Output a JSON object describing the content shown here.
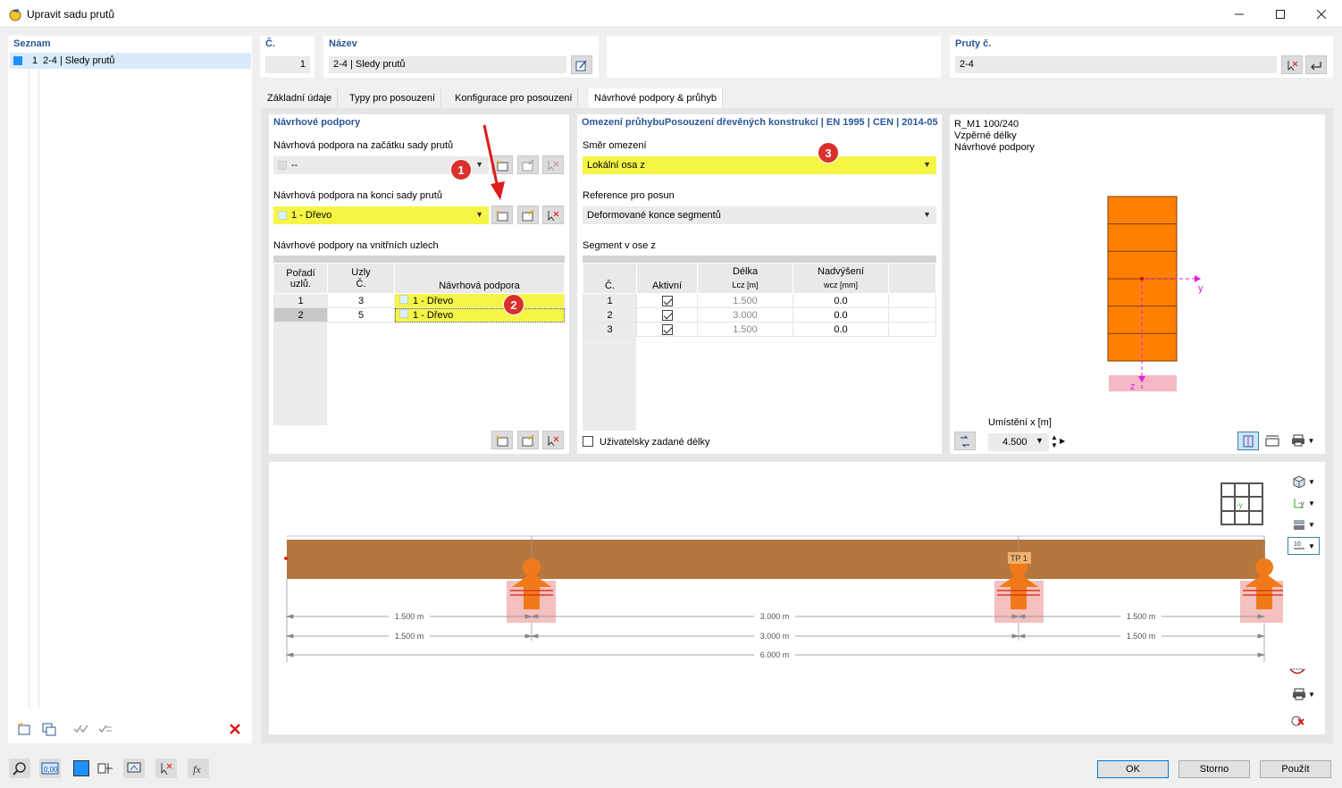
{
  "window": {
    "title": "Upravit sadu prutů"
  },
  "list": {
    "header": "Seznam",
    "items": [
      {
        "number": "1",
        "label": "2-4 | Sledy prutů",
        "color": "#1e90ff"
      }
    ]
  },
  "top": {
    "number_label": "Č.",
    "number_value": "1",
    "name_label": "Název",
    "name_value": "2-4 | Sledy prutů",
    "members_label": "Pruty č.",
    "members_value": "2-4"
  },
  "tabs": [
    {
      "label": "Základní údaje"
    },
    {
      "label": "Typy pro posouzení"
    },
    {
      "label": "Konfigurace pro posouzení"
    },
    {
      "label": "Návrhové podpory & průhyb"
    }
  ],
  "design_supports": {
    "header": "Návrhové podpory",
    "start_label": "Návrhová podpora na začátku sady prutů",
    "start_value": "--",
    "end_label": "Návrhová podpora na konci sady prutů",
    "end_value": "1 - Dřevo",
    "inner_label": "Návrhové podpory na vnitřních uzlech",
    "table": {
      "col_order": "Pořadí uzlů.",
      "col_nodes": "Uzly",
      "col_nodes_sub": "Č.",
      "col_support": "Návrhová podpora",
      "rows": [
        {
          "order": "1",
          "node": "3",
          "support": "1 - Dřevo"
        },
        {
          "order": "2",
          "node": "5",
          "support": "1 - Dřevo"
        }
      ]
    }
  },
  "deflection": {
    "header": "Omezení průhybu",
    "header_extra": "Posouzení dřevěných konstrukcí | EN 1995 | CEN | 2014-05",
    "direction_label": "Směr omezení",
    "direction_value": "Lokální osa z",
    "reference_label": "Reference pro posun",
    "reference_value": "Deformované konce segmentů",
    "segment_label": "Segment v ose z",
    "table": {
      "col_no": "Č.",
      "col_active": "Aktivní",
      "col_length": "Délka",
      "col_length_sub": "Lcz [m]",
      "col_camber": "Nadvýšení",
      "col_camber_sub": "wcz [mm]",
      "rows": [
        {
          "no": "1",
          "active": true,
          "length": "1.500",
          "camber": "0.0"
        },
        {
          "no": "2",
          "active": true,
          "length": "3.000",
          "camber": "0.0"
        },
        {
          "no": "3",
          "active": true,
          "length": "1.500",
          "camber": "0.0"
        }
      ]
    },
    "user_lengths_label": "Uživatelsky zadané délky"
  },
  "section": {
    "line1": "R_M1 100/240",
    "line2": "Vzpěrné délky",
    "line3": "Návrhové podpory",
    "axis_y": "y",
    "axis_z": "z",
    "location_label": "Umístění x [m]",
    "location_value": "4.500"
  },
  "beam": {
    "view_label": "-y",
    "support_label": "TP 1",
    "dims_row1": [
      "1.500 m",
      "3.000 m",
      "1.500 m"
    ],
    "dims_row2": [
      "1.500 m",
      "3.000 m",
      "1.500 m"
    ],
    "dims_total": "6.000 m",
    "toolbar_number": "10"
  },
  "buttons": {
    "ok": "OK",
    "cancel": "Storno",
    "apply": "Použít"
  },
  "status_icons": {
    "value_icon": "0,00"
  },
  "annotations": {
    "b1": "1",
    "b2": "2",
    "b3": "3"
  },
  "colors": {
    "accent": "#2b579a",
    "highlight": "#f5f546",
    "timber": "#b5773d",
    "section": "#ff8000",
    "support": "#f07a1a"
  }
}
